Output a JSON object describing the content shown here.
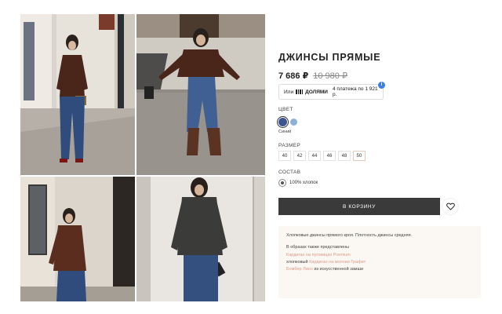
{
  "product": {
    "title": "ДЖИНСЫ ПРЯМЫЕ",
    "price": "7 686 ₽",
    "old_price": "10 980 ₽"
  },
  "installments": {
    "prefix": "Или",
    "brand": "ДОЛЯМИ",
    "text": "4 платежа по 1 921 р.",
    "info_icon": "i"
  },
  "color": {
    "label": "ЦВЕТ",
    "selected_name": "Синий",
    "swatches": [
      "#3d5691",
      "#8db0d6"
    ]
  },
  "size": {
    "label": "РАЗМЕР",
    "options": [
      "40",
      "42",
      "44",
      "46",
      "48",
      "50"
    ],
    "selected": "50"
  },
  "composition": {
    "label": "СОСТАВ",
    "value": "100% хлопок"
  },
  "actions": {
    "add_to_cart": "В КОРЗИНУ",
    "favorite_icon": "heart-icon"
  },
  "description": {
    "text": "Хлопковые джинсы прямого кроя. Плотность джинсы средняя.",
    "looks_intro": "В образах также представлены",
    "line1_link": "Кардиган на пуговицах Premium",
    "line2_prefix": "хлопковый",
    "line2_link": "Кардиган на молнии Графит",
    "line3_link": "Бомбер Лион",
    "line3_suffix": "из искусственной замши"
  },
  "colors": {
    "accent_link": "#d99c8c",
    "button_bg": "#3a3a3a",
    "description_bg": "#fbf7f2"
  }
}
